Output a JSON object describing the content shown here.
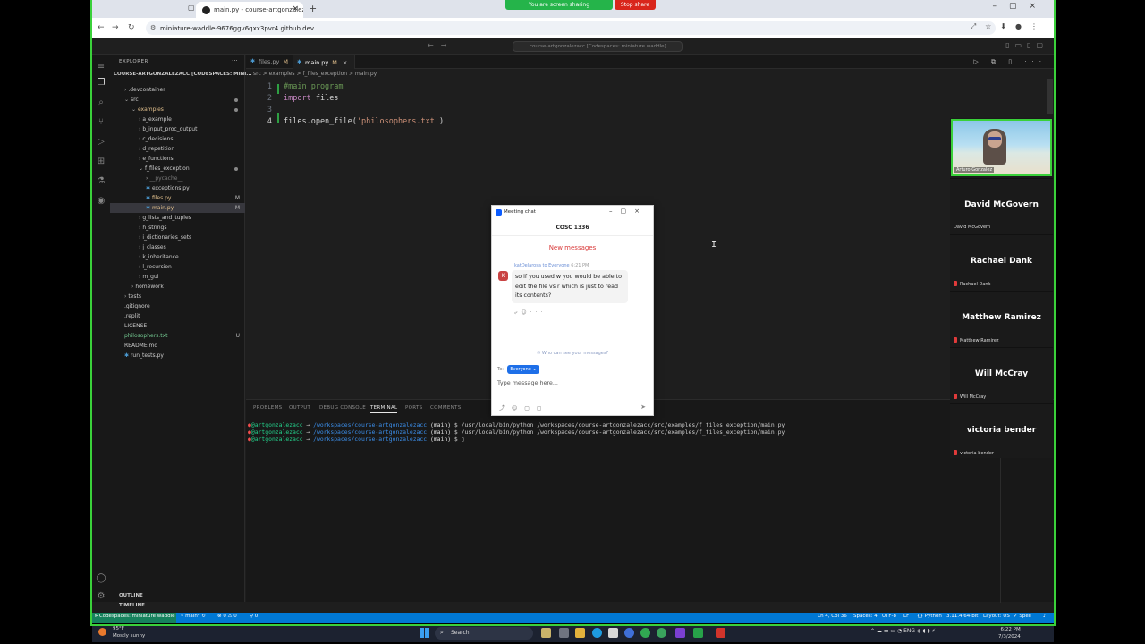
{
  "browser": {
    "tab_title": "main.py - course-artgonzalezac...",
    "url": "miniature-waddle-9676ggv6qxx3pvr4.github.dev"
  },
  "share": {
    "sharing_text": "You are screen sharing",
    "stop_label": "Stop share"
  },
  "vscode": {
    "command_center": "course-artgonzalezacc [Codespaces: miniature waddle]",
    "explorer_title": "EXPLORER",
    "root_label": "COURSE-ARTGONZALEZACC [CODESPACES: MINI...",
    "tree": [
      {
        "label": ".devcontainer",
        "indent": 1,
        "chev": ">"
      },
      {
        "label": "src",
        "indent": 1,
        "chev": "v",
        "dot": true
      },
      {
        "label": "examples",
        "indent": 2,
        "chev": "v",
        "dot": true,
        "color": "mod"
      },
      {
        "label": "a_example",
        "indent": 3,
        "chev": ">"
      },
      {
        "label": "b_input_proc_output",
        "indent": 3,
        "chev": ">"
      },
      {
        "label": "c_decisions",
        "indent": 3,
        "chev": ">"
      },
      {
        "label": "d_repetition",
        "indent": 3,
        "chev": ">"
      },
      {
        "label": "e_functions",
        "indent": 3,
        "chev": ">"
      },
      {
        "label": "f_files_exception",
        "indent": 3,
        "chev": "v",
        "dot": true
      },
      {
        "label": "__pycache__",
        "indent": 4,
        "chev": ">",
        "dim": true
      },
      {
        "label": "exceptions.py",
        "indent": 4,
        "py": true
      },
      {
        "label": "files.py",
        "indent": 4,
        "py": true,
        "badge": "M",
        "color": "mod"
      },
      {
        "label": "main.py",
        "indent": 4,
        "py": true,
        "badge": "M",
        "color": "mod",
        "selected": true
      },
      {
        "label": "g_lists_and_tuples",
        "indent": 3,
        "chev": ">"
      },
      {
        "label": "h_strings",
        "indent": 3,
        "chev": ">"
      },
      {
        "label": "i_dictionaries_sets",
        "indent": 3,
        "chev": ">"
      },
      {
        "label": "j_classes",
        "indent": 3,
        "chev": ">"
      },
      {
        "label": "k_inheritance",
        "indent": 3,
        "chev": ">"
      },
      {
        "label": "l_recursion",
        "indent": 3,
        "chev": ">"
      },
      {
        "label": "m_gui",
        "indent": 3,
        "chev": ">"
      },
      {
        "label": "homework",
        "indent": 2,
        "chev": ">"
      },
      {
        "label": "tests",
        "indent": 1,
        "chev": ">"
      },
      {
        "label": ".gitignore",
        "indent": 1
      },
      {
        "label": ".replit",
        "indent": 1
      },
      {
        "label": "LICENSE",
        "indent": 1
      },
      {
        "label": "philosophers.txt",
        "indent": 1,
        "badge": "U",
        "color": "green"
      },
      {
        "label": "README.md",
        "indent": 1
      },
      {
        "label": "run_tests.py",
        "indent": 1,
        "py": true
      }
    ],
    "outline_label": "OUTLINE",
    "timeline_label": "TIMELINE",
    "tabs": [
      {
        "label": "files.py",
        "badge": "M"
      },
      {
        "label": "main.py",
        "badge": "M",
        "active": true
      }
    ],
    "breadcrumb": "src > examples > f_files_exception > main.py",
    "code_lines": [
      {
        "num": "1",
        "text": "#main program"
      },
      {
        "num": "2",
        "text": "import files"
      },
      {
        "num": "3",
        "text": ""
      },
      {
        "num": "4",
        "text": "files.open_file('philosophers.txt')"
      }
    ],
    "panel_tabs": [
      "PROBLEMS",
      "OUTPUT",
      "DEBUG CONSOLE",
      "TERMINAL",
      "PORTS",
      "COMMENTS"
    ],
    "terminal": {
      "user": "@artgonzalezacc",
      "path": "/workspaces/course-artgonzalezacc",
      "branch": "(main)",
      "command": "/usr/local/bin/python /workspaces/course-artgonzalezacc/src/examples/f_files_exception/main.py"
    },
    "status": {
      "remote": "Codespaces: miniature waddle",
      "branch": "main*",
      "problems": "0 ⚠ 0",
      "ports": "0",
      "position": "Ln 4, Col 36",
      "spaces": "Spaces: 4",
      "encoding": "UTF-8",
      "eol": "LF",
      "language": "Python",
      "interpreter": "3.11.4 64-bit",
      "layout": "Layout: US",
      "spell": "Spell"
    }
  },
  "chat": {
    "window_title": "Meeting chat",
    "channel": "COSC 1336",
    "new_messages": "New messages",
    "sender": "katDelarosa",
    "to": "to Everyone",
    "time": "6:21 PM",
    "message": "so if you used w you would be able to edit the file vs r which is just to read its contents?",
    "who_see": "Who can see your messages?",
    "to_label": "To:",
    "recipient": "Everyone",
    "placeholder": "Type message here..."
  },
  "participants": {
    "video_name": "Arturo Gonzalez",
    "list": [
      {
        "big": "David McGovern",
        "small": "David McGovern",
        "muted": false
      },
      {
        "big": "Rachael Dank",
        "small": "Rachael Dank",
        "muted": true
      },
      {
        "big": "Matthew Ramirez",
        "small": "Matthew Ramirez",
        "muted": true
      },
      {
        "big": "Will McCray",
        "small": "Will McCray",
        "muted": true
      },
      {
        "big": "victoria bender",
        "small": "victoria bender",
        "muted": true
      }
    ]
  },
  "taskbar": {
    "temp": "95°F",
    "weather": "Mostly sunny",
    "search": "Search",
    "lang": "ENG",
    "time": "6:22 PM",
    "date": "7/3/2024"
  }
}
